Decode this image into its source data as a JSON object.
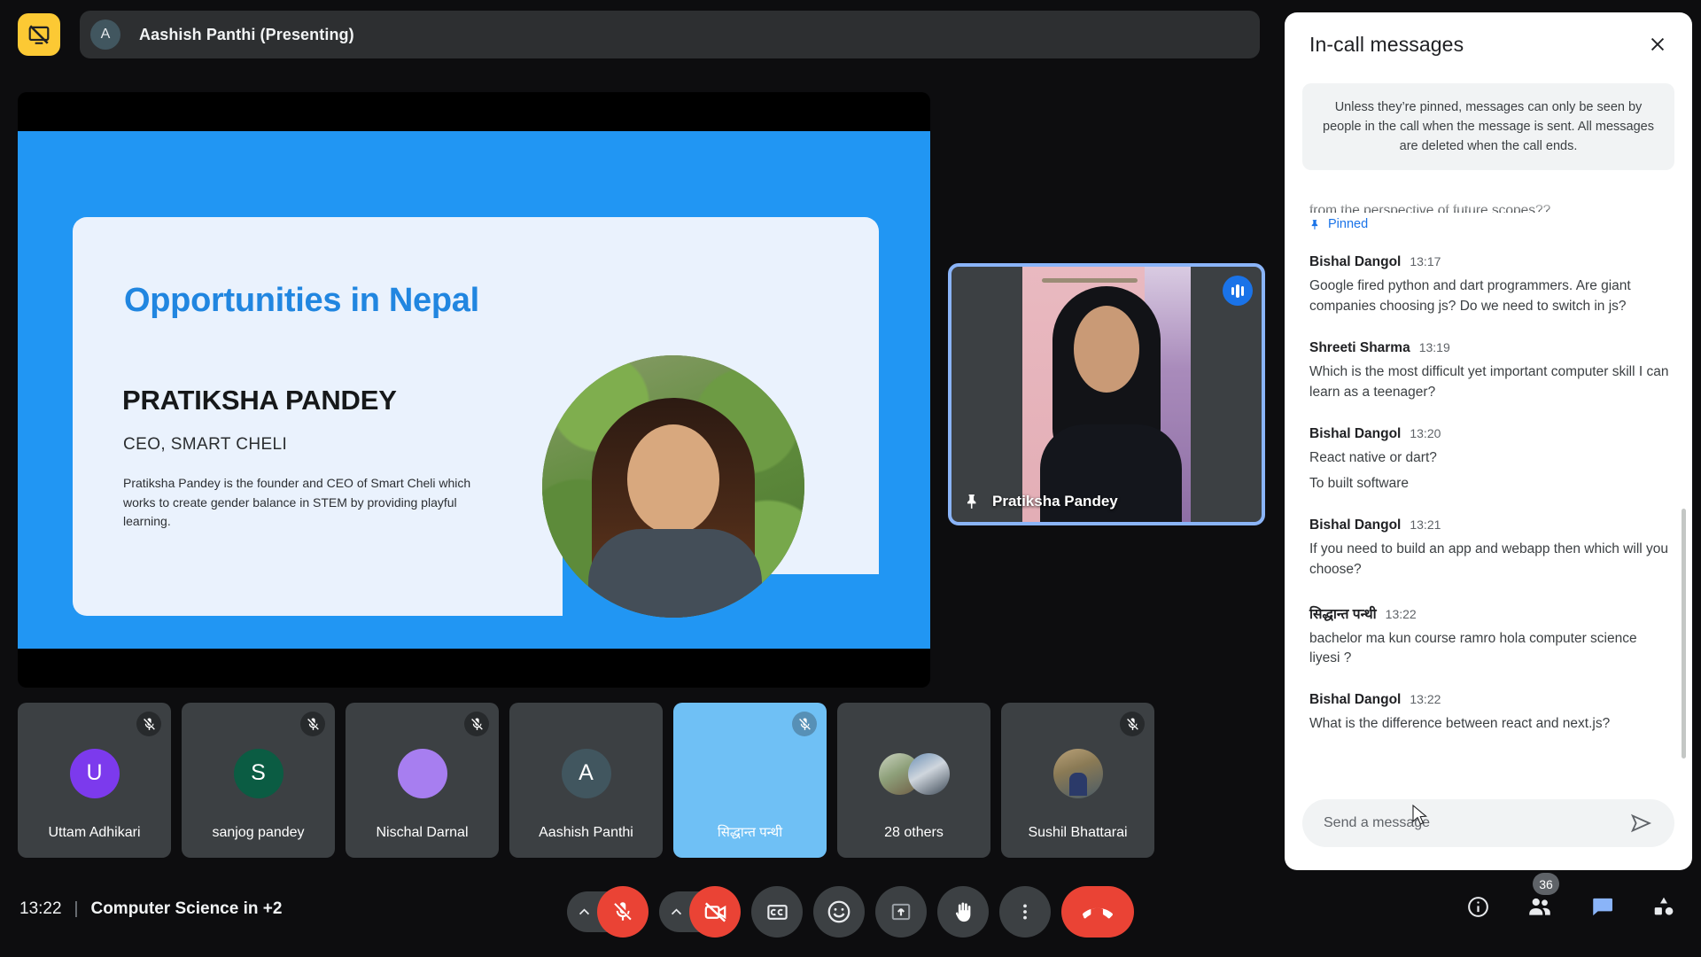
{
  "topbar": {
    "present_icon": "stop-presenting-icon",
    "presenter_initial": "A",
    "presenter_label": "Aashish Panthi (Presenting)"
  },
  "slide": {
    "title": "Opportunities in Nepal",
    "person_name": "PRATIKSHA PANDEY",
    "person_role": "CEO, SMART CHELI",
    "description": "Pratiksha Pandey is the founder and CEO of Smart Cheli which works to create gender balance in STEM by providing playful learning.",
    "bg_color": "#2196f3",
    "card_color": "#eaf2fd",
    "title_color": "#2186e0"
  },
  "self_tile": {
    "name": "Pratiksha Pandey",
    "pinned": true,
    "pin_icon": "pin-icon",
    "speaking_icon": "audio-levels-icon",
    "border_color": "#8ab4f8"
  },
  "participants": [
    {
      "name": "Uttam Adhikari",
      "initial": "U",
      "avatar_color": "#7c3aed",
      "muted": true,
      "active": false,
      "kind": "initial"
    },
    {
      "name": "sanjog pandey",
      "initial": "S",
      "avatar_color": "#0b5c43",
      "muted": true,
      "active": false,
      "kind": "initial"
    },
    {
      "name": "Nischal Darnal",
      "initial": "",
      "avatar_color": "#a77ef0",
      "muted": true,
      "active": false,
      "kind": "initial"
    },
    {
      "name": "Aashish Panthi",
      "initial": "A",
      "avatar_color": "#41565f",
      "muted": false,
      "active": false,
      "kind": "initial"
    },
    {
      "name": "सिद्धान्त पन्थी",
      "initial": "",
      "avatar_color": "",
      "muted": true,
      "active": true,
      "kind": "blank"
    },
    {
      "name": "28 others",
      "initial": "",
      "avatar_color": "",
      "muted": false,
      "active": false,
      "kind": "others"
    },
    {
      "name": "Sushil Bhattarai",
      "initial": "",
      "avatar_color": "",
      "muted": true,
      "active": false,
      "kind": "photo"
    }
  ],
  "bottom": {
    "time": "13:22",
    "separator": "|",
    "meeting_title": "Computer Science in +2",
    "controls": [
      {
        "name": "microphone-options",
        "icon": "chevron-up-icon"
      },
      {
        "name": "microphone-toggle",
        "icon": "mic-off-icon",
        "state": "muted"
      },
      {
        "name": "camera-options",
        "icon": "chevron-up-icon"
      },
      {
        "name": "camera-toggle",
        "icon": "video-off-icon",
        "state": "off"
      },
      {
        "name": "captions-toggle",
        "icon": "closed-captions-icon"
      },
      {
        "name": "reactions",
        "icon": "emoji-smiley-icon"
      },
      {
        "name": "present-now",
        "icon": "present-screen-icon"
      },
      {
        "name": "raise-hand",
        "icon": "raised-hand-icon"
      },
      {
        "name": "more-options",
        "icon": "more-vertical-icon"
      },
      {
        "name": "leave-call",
        "icon": "end-call-icon"
      }
    ],
    "right_controls": [
      {
        "name": "meeting-details",
        "icon": "info-icon",
        "badge": ""
      },
      {
        "name": "participants",
        "icon": "people-icon",
        "badge": "36"
      },
      {
        "name": "chat",
        "icon": "chat-bubble-icon",
        "badge": "",
        "active": true
      },
      {
        "name": "activities",
        "icon": "activities-shapes-icon",
        "badge": ""
      }
    ],
    "danger_color": "#ea4335",
    "badge_count": "36"
  },
  "chat": {
    "title": "In-call messages",
    "close_icon": "close-icon",
    "notice": "Unless they’re pinned, messages can only be seen by people in the call when the message is sent. All messages are deleted when the call ends.",
    "pinned_clipped_text": "from the perspective of future scopes??",
    "pinned_label": "Pinned",
    "pinned_icon": "pin-icon",
    "messages": [
      {
        "author": "Bishal Dangol",
        "time": "13:17",
        "lines": [
          "Google fired python and dart programmers. Are giant companies choosing js? Do we need to switch in js?"
        ]
      },
      {
        "author": "Shreeti Sharma",
        "time": "13:19",
        "lines": [
          "Which is the most difficult yet important computer skill I can learn as a teenager?"
        ]
      },
      {
        "author": "Bishal Dangol",
        "time": "13:20",
        "lines": [
          "React native or dart?",
          "To built software"
        ]
      },
      {
        "author": "Bishal Dangol",
        "time": "13:21",
        "lines": [
          "If you need to build an app and webapp then which will you choose?"
        ]
      },
      {
        "author": "सिद्धान्त पन्थी",
        "time": "13:22",
        "lines": [
          "bachelor ma kun course ramro hola computer science liyesi ?"
        ]
      },
      {
        "author": "Bishal Dangol",
        "time": "13:22",
        "lines": [
          "What is the difference between react and next.js?"
        ]
      }
    ],
    "composer_placeholder": "Send a message",
    "composer_value": "",
    "send_icon": "send-icon"
  }
}
